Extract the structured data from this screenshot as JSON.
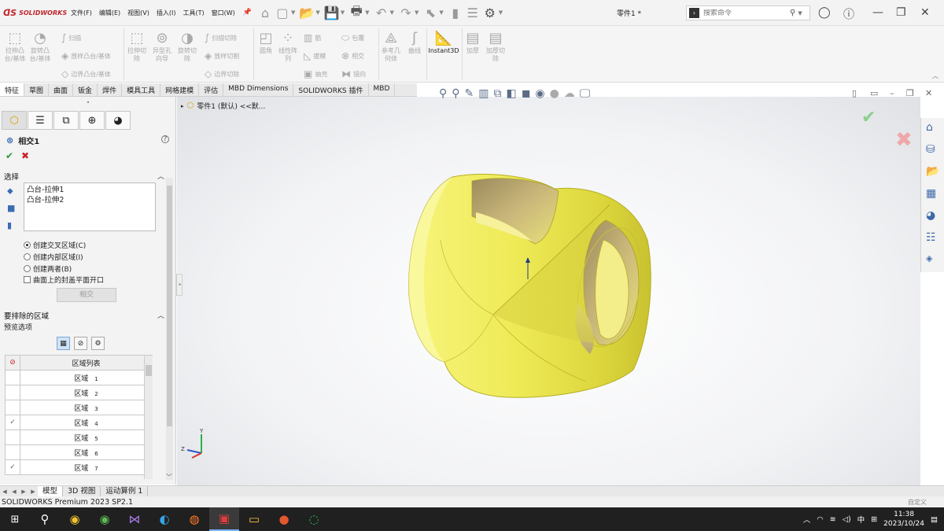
{
  "app": {
    "brand": "SOLIDWORKS",
    "document_title": "零件1 *",
    "menu": [
      "文件(F)",
      "编辑(E)",
      "视图(V)",
      "插入(I)",
      "工具(T)",
      "窗口(W)"
    ],
    "search_placeholder": "搜索命令"
  },
  "ribbon": {
    "extrude_boss": "拉伸凸台/基体",
    "revolve_boss": "旋转凸台/基体",
    "sweep": "扫描",
    "loft_boss": "放样凸台/基体",
    "boundary_boss": "边界凸台/基体",
    "extrude_cut": "拉伸切除",
    "hole_wizard": "异型孔向导",
    "revolve_cut": "旋转切除",
    "swept_cut": "扫描切除",
    "lofted_cut": "放样切割",
    "boundary_cut": "边界切除",
    "fillet": "圆角",
    "linear_pattern": "线性阵列",
    "rib": "筋",
    "draft": "拔模",
    "shell": "抽壳",
    "wrap": "包覆",
    "intersect": "相交",
    "mirror": "镜向",
    "ref_geometry": "参考几何体",
    "curves": "曲线",
    "instant3d": "Instant3D",
    "thicken": "加厚",
    "thicken_cut": "加厚切除"
  },
  "command_tabs": [
    "特征",
    "草图",
    "曲面",
    "钣金",
    "焊件",
    "模具工具",
    "网格建模",
    "评估",
    "MBD Dimensions",
    "SOLIDWORKS 插件",
    "MBD"
  ],
  "tree": {
    "part_label": "零件1 (默认) <<默..."
  },
  "property_manager": {
    "title": "相交1",
    "selection_header": "选择",
    "selections": [
      "凸台-拉伸1",
      "凸台-拉伸2"
    ],
    "options": [
      {
        "label": "创建交叉区域(C)",
        "selected": true
      },
      {
        "label": "创建内部区域(I)",
        "selected": false
      },
      {
        "label": "创建两者(B)",
        "selected": false
      }
    ],
    "cap_option": "曲面上的封盖平面开口",
    "intersect_button": "相交",
    "exclude_header": "要排除的区域",
    "preview_label": "预览选项",
    "table_header": "区域列表",
    "regions": [
      {
        "name": "区域",
        "id": "1",
        "checked": false
      },
      {
        "name": "区域",
        "id": "2",
        "checked": false
      },
      {
        "name": "区域",
        "id": "3",
        "checked": false
      },
      {
        "name": "区域",
        "id": "4",
        "checked": true
      },
      {
        "name": "区域",
        "id": "5",
        "checked": false
      },
      {
        "name": "区域",
        "id": "6",
        "checked": false
      },
      {
        "name": "区域",
        "id": "7",
        "checked": true
      }
    ]
  },
  "bottom_tabs": [
    "模型",
    "3D 视图",
    "运动算例 1"
  ],
  "status": {
    "version": "SOLIDWORKS Premium 2023 SP2.1",
    "custom": "自定义"
  },
  "taskbar": {
    "ime": "中",
    "time": "11:38",
    "date": "2023/10/24"
  },
  "colors": {
    "model_yellow": "#f0ee6a",
    "brand_red": "#c0282d",
    "accept_green": "#2f9a3b",
    "cancel_red": "#c8242b"
  }
}
